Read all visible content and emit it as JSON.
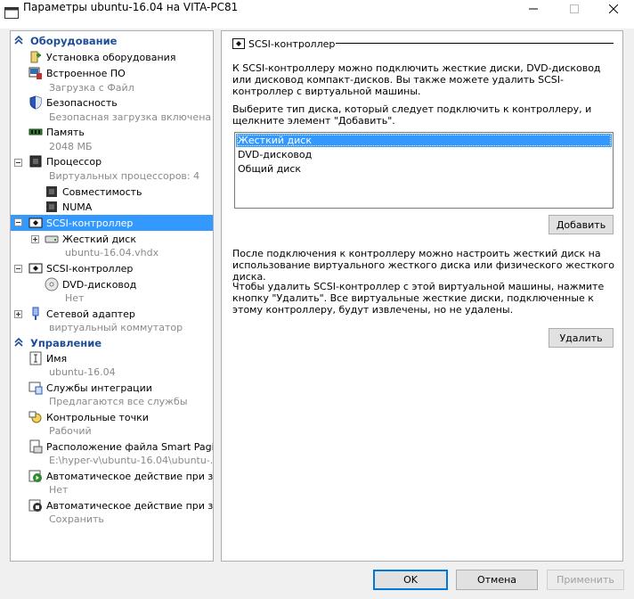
{
  "window": {
    "title": "Параметры ubuntu-16.04 на VITA-PC81"
  },
  "tree": {
    "hardware_header": "Оборудование",
    "add_hardware": "Установка оборудования",
    "firmware": {
      "label": "Встроенное ПО",
      "sub": "Загрузка с Файл"
    },
    "security": {
      "label": "Безопасность",
      "sub": "Безопасная загрузка включена"
    },
    "memory": {
      "label": "Память",
      "sub": "2048 МБ"
    },
    "processor": {
      "label": "Процессор",
      "sub": "Виртуальных процессоров: 4"
    },
    "compat": "Совместимость",
    "numa": "NUMA",
    "scsi1": "SCSI-контроллер",
    "hdd": {
      "label": "Жесткий диск",
      "sub": "ubuntu-16.04.vhdx"
    },
    "scsi2": "SCSI-контроллер",
    "dvd": {
      "label": "DVD-дисковод",
      "sub": "Нет"
    },
    "nic": {
      "label": "Сетевой адаптер",
      "sub": "виртуальный коммутатор"
    },
    "management_header": "Управление",
    "name": {
      "label": "Имя",
      "sub": "ubuntu-16.04"
    },
    "integration": {
      "label": "Службы интеграции",
      "sub": "Предлагаются все службы"
    },
    "checkpoints": {
      "label": "Контрольные точки",
      "sub": "Рабочий"
    },
    "smartpaging": {
      "label": "Расположение файла Smart Paging",
      "sub": "E:\\hyper-v\\ubuntu-16.04\\ubuntu-..."
    },
    "autostart": {
      "label": "Автоматическое действие при за...",
      "sub": "Нет"
    },
    "autostop": {
      "label": "Автоматическое действие при за...",
      "sub": "Сохранить"
    }
  },
  "panel": {
    "header": "SCSI-контроллер",
    "intro": "К SCSI-контроллеру можно подключить жесткие диски, DVD-дисковод или дисковод компакт-дисков. Вы также можете удалить SCSI-контроллер с виртуальной машины.",
    "choose": "Выберите тип диска, который следует подключить к контроллеру, и щелкните элемент \"Добавить\".",
    "options": [
      "Жесткий диск",
      "DVD-дисковод",
      "Общий диск"
    ],
    "add_button": "Добавить",
    "after_connect": "После подключения к контроллеру можно настроить жесткий диск на использование виртуального жесткого диска или физического жесткого диска.",
    "remove_info": "Чтобы удалить SCSI-контроллер с этой виртуальной машины, нажмите кнопку \"Удалить\". Все виртуальные жесткие диски, подключенные к этому контроллеру, будут извлечены, но не удалены.",
    "remove_button": "Удалить"
  },
  "footer": {
    "ok": "OK",
    "cancel": "Отмена",
    "apply": "Применить"
  }
}
